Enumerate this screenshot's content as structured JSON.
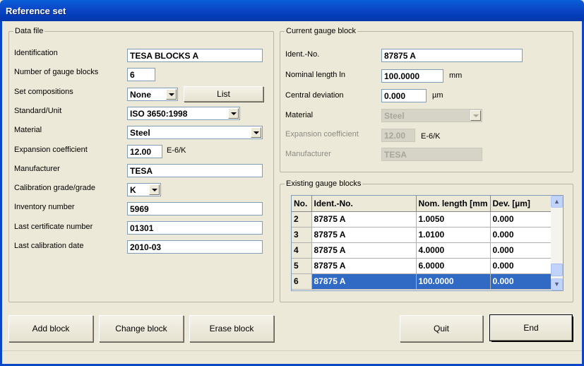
{
  "window": {
    "title": "Reference set"
  },
  "data_file": {
    "title": "Data file",
    "identification": {
      "label": "Identification",
      "value": "TESA BLOCKS A"
    },
    "number_blocks": {
      "label": "Number of gauge blocks",
      "value": "6"
    },
    "set_compositions": {
      "label": "Set compositions",
      "value": "None",
      "list_button": "List"
    },
    "standard_unit": {
      "label": "Standard/Unit",
      "value": "ISO 3650:1998"
    },
    "material": {
      "label": "Material",
      "value": "Steel"
    },
    "expansion": {
      "label": "Expansion coefficient",
      "value": "12.00",
      "unit": "E-6/K"
    },
    "manufacturer": {
      "label": "Manufacturer",
      "value": "TESA"
    },
    "calibration_grade": {
      "label": "Calibration grade/grade",
      "value": "K"
    },
    "inventory": {
      "label": "Inventory number",
      "value": "5969"
    },
    "last_certificate": {
      "label": "Last certificate number",
      "value": "01301"
    },
    "last_calibration": {
      "label": "Last calibration date",
      "value": "2010-03"
    }
  },
  "current_block": {
    "title": "Current gauge block",
    "ident": {
      "label": "Ident.-No.",
      "value": "87875 A"
    },
    "nominal": {
      "label": "Nominal length ln",
      "value": "100.0000",
      "unit": "mm"
    },
    "central_dev": {
      "label": "Central deviation",
      "value": "0.000",
      "unit": "µm"
    },
    "material": {
      "label": "Material",
      "value": "Steel"
    },
    "expansion": {
      "label": "Expansion coefficient",
      "value": "12.00",
      "unit": "E-6/K"
    },
    "manufacturer": {
      "label": "Manufacturer",
      "value": "TESA"
    }
  },
  "existing": {
    "title": "Existing gauge blocks",
    "columns": [
      "No.",
      "Ident.-No.",
      "Nom. length [mm",
      "Dev. [µm]"
    ],
    "rows": [
      {
        "no": "2",
        "ident": "87875 A",
        "length": "1.0050",
        "dev": "0.000"
      },
      {
        "no": "3",
        "ident": "87875 A",
        "length": "1.0100",
        "dev": "0.000"
      },
      {
        "no": "4",
        "ident": "87875 A",
        "length": "4.0000",
        "dev": "0.000"
      },
      {
        "no": "5",
        "ident": "87875 A",
        "length": "6.0000",
        "dev": "0.000"
      },
      {
        "no": "6",
        "ident": "87875 A",
        "length": "100.0000",
        "dev": "0.000"
      }
    ],
    "selected_no": "6"
  },
  "buttons": {
    "add": "Add block",
    "change": "Change block",
    "erase": "Erase block",
    "quit": "Quit",
    "end": "End"
  },
  "colors": {
    "titlebar": "#0b46c7",
    "selection": "#316ac5",
    "face": "#ece9d8"
  }
}
